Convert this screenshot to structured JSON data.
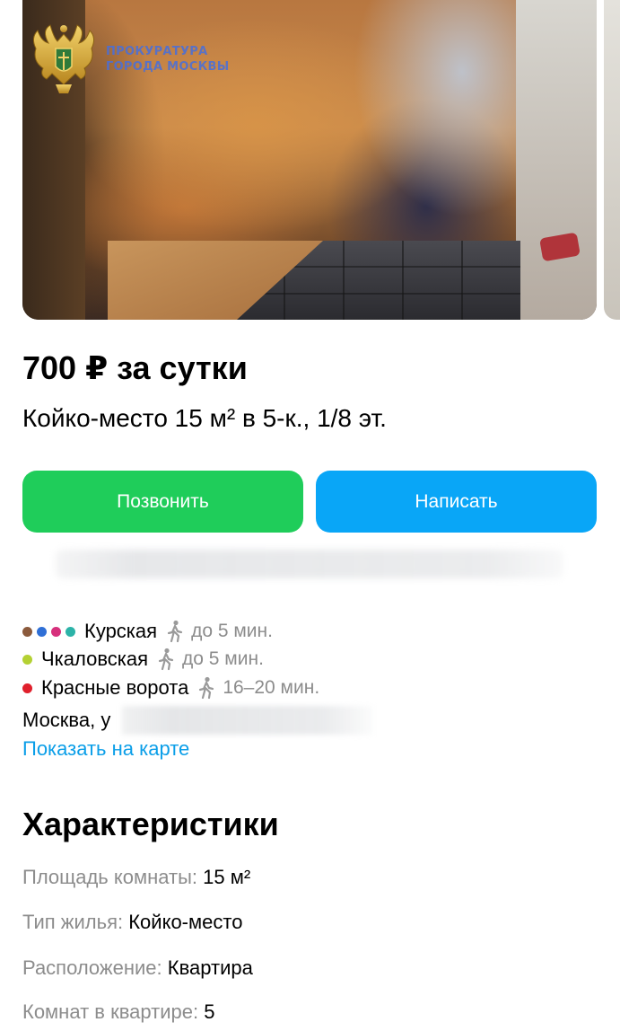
{
  "watermark": {
    "line1": "ПРОКУРАТУРА",
    "line2": "ГОРОДА МОСКВЫ"
  },
  "listing": {
    "price": "700 ₽ за сутки",
    "subtitle": "Койко-место 15 м² в 5-к., 1/8 эт."
  },
  "actions": {
    "call_label": "Позвонить",
    "write_label": "Написать"
  },
  "colors": {
    "call": "#1fcd5a",
    "write": "#09a6f7",
    "link": "#0a9ee8"
  },
  "metro": [
    {
      "station": "Курская",
      "walk": "до 5 мин.",
      "line_colors": [
        "#8b5a3c",
        "#2f6fd6",
        "#d6307c",
        "#2cb3a8"
      ]
    },
    {
      "station": "Чкаловская",
      "walk": "до 5 мин.",
      "line_colors": [
        "#b4d133"
      ]
    },
    {
      "station": "Красные ворота",
      "walk": "16–20 мин.",
      "line_colors": [
        "#e0202c"
      ]
    }
  ],
  "address": {
    "visible": "Москва, у"
  },
  "map_link": "Показать на карте",
  "characteristics": {
    "title": "Характеристики",
    "items": [
      {
        "key": "Площадь комнаты:",
        "value": "15 м²"
      },
      {
        "key": "Тип жилья:",
        "value": "Койко-место"
      },
      {
        "key": "Расположение:",
        "value": "Квартира"
      },
      {
        "key": "Комнат в квартире:",
        "value": "5"
      }
    ]
  }
}
